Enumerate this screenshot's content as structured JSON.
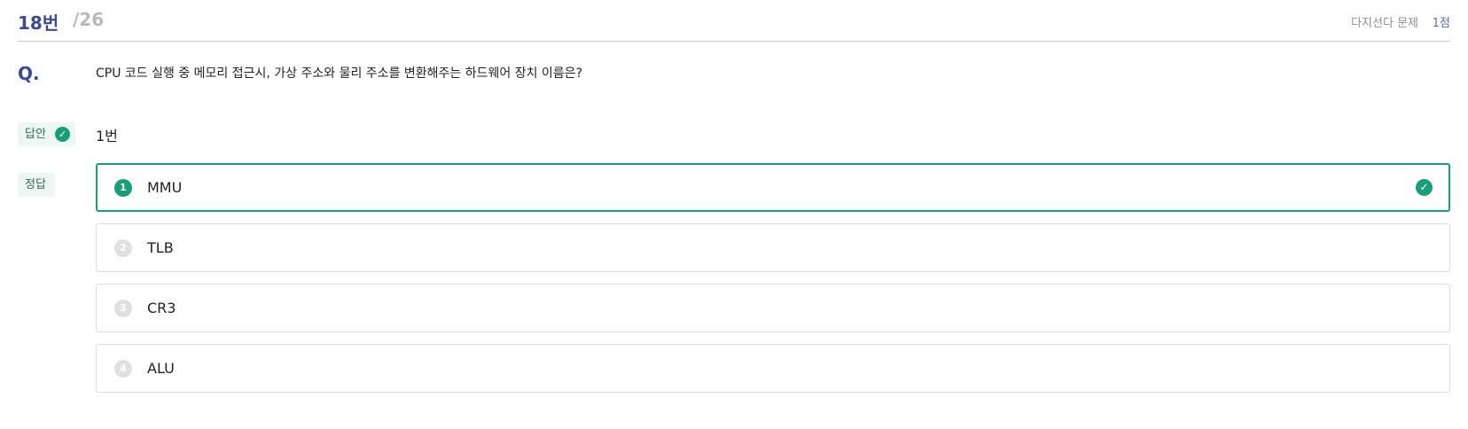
{
  "header": {
    "question_number": "18번",
    "question_total": "/26",
    "question_type": "다지선다 문제",
    "score": "1점"
  },
  "question": {
    "label": "Q.",
    "text": "CPU 코드 실행 중 메모리 접근시, 가상 주소와 물리 주소를 변환해주는 하드웨어 장치 이름은?"
  },
  "answer": {
    "label": "답안",
    "value": "1번",
    "status_icon": "check-circle-icon"
  },
  "correct": {
    "label": "정답"
  },
  "options": [
    {
      "number": "1",
      "label": "MMU",
      "is_correct": true
    },
    {
      "number": "2",
      "label": "TLB",
      "is_correct": false
    },
    {
      "number": "3",
      "label": "CR3",
      "is_correct": false
    },
    {
      "number": "4",
      "label": "ALU",
      "is_correct": false
    }
  ],
  "colors": {
    "accent": "#3d4a8f",
    "correct": "#1a9e7a",
    "muted": "#b9b9b9"
  }
}
